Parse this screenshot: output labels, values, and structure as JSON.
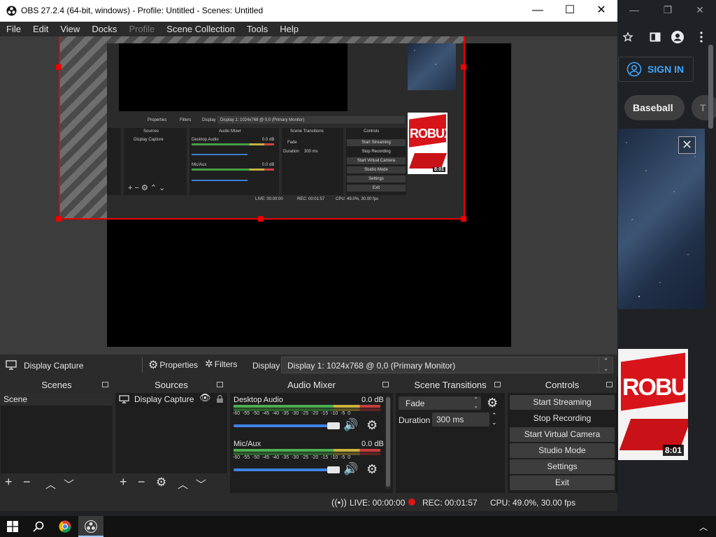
{
  "chrome": {
    "window_buttons": {
      "minimize": "—",
      "restore": "❐",
      "close": "✕"
    },
    "sign_in_label": "SIGN IN",
    "chips": [
      "Baseball",
      "T"
    ],
    "thumbnail_title": "ROBUX",
    "thumbnail_duration": "8:01",
    "close_icon_glyph": "✕"
  },
  "obs": {
    "title": "OBS 27.2.4 (64-bit, windows) - Profile: Untitled - Scenes: Untitled",
    "window_buttons": {
      "minimize": "—",
      "maximize": "☐",
      "close": "✕"
    },
    "menu": [
      "File",
      "Edit",
      "View",
      "Docks",
      "Profile",
      "Scene Collection",
      "Tools",
      "Help"
    ],
    "source_bar": {
      "source_name": "Display Capture",
      "properties_label": "Properties",
      "filters_label": "Filters",
      "display_label": "Display",
      "display_value": "Display 1: 1024x768 @ 0,0 (Primary Monitor)"
    },
    "scenes": {
      "title": "Scenes",
      "items": [
        "Scene"
      ]
    },
    "sources": {
      "title": "Sources",
      "items": [
        "Display Capture"
      ]
    },
    "audio_mixer": {
      "title": "Audio Mixer",
      "channels": [
        {
          "name": "Desktop Audio",
          "level": "0.0 dB",
          "volume_fraction": 0.93
        },
        {
          "name": "Mic/Aux",
          "level": "0.0 dB",
          "volume_fraction": 0.93
        }
      ],
      "scale": [
        "-60",
        "-55",
        "-50",
        "-45",
        "-40",
        "-35",
        "-30",
        "-25",
        "-20",
        "-15",
        "-10",
        "-5",
        "0"
      ]
    },
    "scene_transitions": {
      "title": "Scene Transitions",
      "transition": "Fade",
      "duration_label": "Duration",
      "duration_value": "300 ms"
    },
    "controls": {
      "title": "Controls",
      "buttons": [
        "Start Streaming",
        "Stop Recording",
        "Start Virtual Camera",
        "Studio Mode",
        "Settings",
        "Exit"
      ]
    },
    "status": {
      "live": "LIVE: 00:00:00",
      "rec": "REC: 00:01:57",
      "cpu": "CPU: 49.0%, 30.00 fps"
    },
    "nested_preview": {
      "properties": "Properties",
      "filters": "Filters",
      "display": "Display",
      "display_value": "Display 1: 1024x768 @ 0,0 (Primary Monitor)",
      "sources": "Sources",
      "source_item": "Display Capture",
      "audio_mixer": "Audio Mixer",
      "desktop_audio": "Desktop Audio",
      "desktop_level": "0.0 dB",
      "mic": "Mic/Aux",
      "mic_level": "0.0 dB",
      "scene_transitions": "Scene Transitions",
      "fade": "Fade",
      "duration": "Duration",
      "duration_value": "300 ms",
      "controls": "Controls",
      "buttons": [
        "Start Streaming",
        "Stop Recording",
        "Start Virtual Camera",
        "Studio Mode",
        "Settings",
        "Exit"
      ],
      "live": "LIVE: 00:00:00",
      "rec": "REC: 00:01:57",
      "cpu": "CPU: 49.0%, 30.00 fps",
      "robux": "ROBUX",
      "duration_badge": "8:01"
    }
  },
  "colors": {
    "selection_red": "#e00000",
    "obs_bg": "#2b2b2b",
    "dock_bg": "#1e1e1e",
    "signin_blue": "#3ea6ff",
    "volume_blue": "#3f84e5"
  }
}
